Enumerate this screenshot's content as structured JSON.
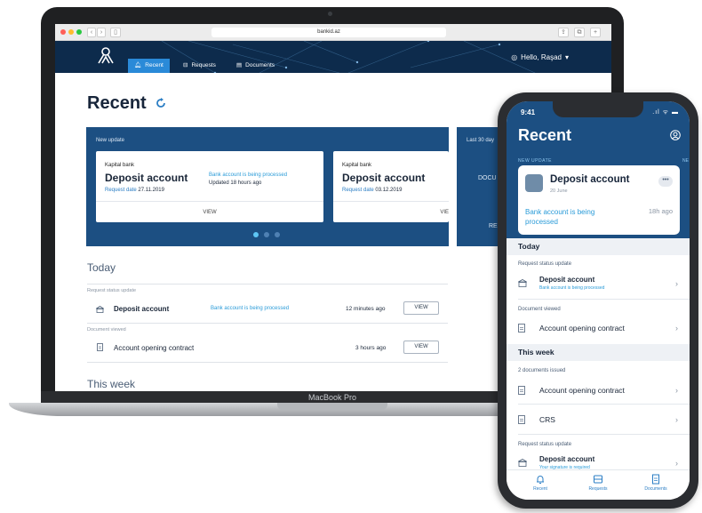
{
  "browser": {
    "url": "bankid.az",
    "colors": {
      "close": "#ff5f57",
      "minimize": "#febc2e",
      "zoom": "#28c840"
    }
  },
  "desktop": {
    "nav": {
      "recent": "Recent",
      "requests": "Requests",
      "documents": "Documents",
      "greeting": "Hello, Raşad"
    },
    "title": "Recent",
    "new_update": {
      "label": "New update",
      "cards": [
        {
          "bank": "Kapital bank",
          "account": "Deposit account",
          "request_label": "Request date",
          "request_date": "27.11.2019",
          "status": "Bank account is being processed",
          "updated": "Updated 18 hours ago",
          "view": "VIEW"
        },
        {
          "bank": "Kapital bank",
          "account": "Deposit account",
          "request_label": "Request date",
          "request_date": "03.12.2019",
          "view": "VIE"
        }
      ]
    },
    "last30": {
      "label": "Last 30 day",
      "docs": "DOCU",
      "req": "REC"
    },
    "today": {
      "heading": "Today",
      "groups": [
        {
          "label": "Request status update",
          "name": "Deposit account",
          "status": "Bank account is being processed",
          "time": "12 minutes ago",
          "action": "VIEW"
        },
        {
          "label": "Document viewed",
          "name": "Account opening contract",
          "time": "3 hours ago",
          "action": "VIEW"
        }
      ]
    },
    "this_week": "This week",
    "device_label": "MacBook Pro"
  },
  "phone": {
    "time": "9:41",
    "signal": ".ıl ᯤ ▬",
    "title": "Recent",
    "new_update_label": "NEW UPDATE",
    "new_update_label_next": "NE",
    "card": {
      "name": "Deposit account",
      "date": "20 June",
      "more": "•••",
      "status": "Bank account is being processed",
      "ago": "18h ago"
    },
    "sections": {
      "today": "Today",
      "this_week": "This week"
    },
    "today_items": [
      {
        "label": "Request status update",
        "name": "Deposit account",
        "status": "Bank account is being processed"
      },
      {
        "label": "Document viewed",
        "name": "Account opening contract"
      }
    ],
    "week_label": "2 documents issued",
    "week_items": [
      {
        "name": "Account opening contract"
      },
      {
        "name": "CRS"
      }
    ],
    "week_update": {
      "label": "Request status update",
      "name": "Deposit account",
      "status": "Your signature is required"
    },
    "tabs": {
      "recent": "Recent",
      "requests": "Requests",
      "documents": "Documents"
    }
  },
  "colors": {
    "brand_navy": "#0d2b4c",
    "card_blue": "#1c4f82",
    "accent": "#2a9bd8",
    "active_tab": "#2a8ad8"
  }
}
